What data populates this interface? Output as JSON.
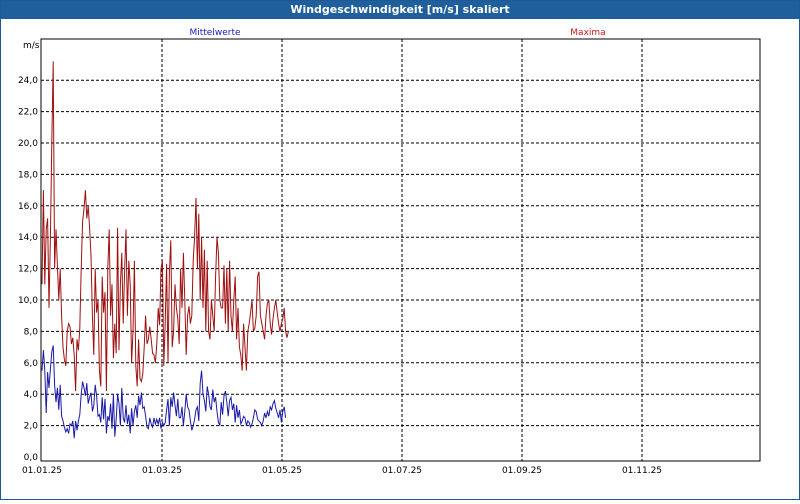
{
  "window": {
    "title": "Windgeschwindigkeit [m/s] skaliert"
  },
  "legend": {
    "series_1": "Mittelwerte",
    "series_2": "Maxima"
  },
  "colors": {
    "mean": "#1a1aa8",
    "max": "#a01010",
    "grid": "#000000",
    "legend_mean": "#1a1acc",
    "legend_max": "#cc1a1a"
  },
  "chart_data": {
    "type": "line",
    "title": "Windgeschwindigkeit [m/s] skaliert",
    "ylabel": "m/s",
    "ylim": [
      0,
      25
    ],
    "yticks": [
      "0,0",
      "2,0",
      "4,0",
      "6,0",
      "8,0",
      "10,0",
      "12,0",
      "14,0",
      "16,0",
      "18,0",
      "20,0",
      "22,0",
      "24,0"
    ],
    "xticks": [
      "01.01.25",
      "01.03.25",
      "01.05.25",
      "01.07.25",
      "01.09.25",
      "01.11.25"
    ],
    "grid": true,
    "legend_position": "top",
    "series": [
      {
        "name": "Mittelwerte",
        "values": [
          5.5,
          6.8,
          5.5,
          2.8,
          5.4,
          4.4,
          5.6,
          6.7,
          7.1,
          4.6,
          3.5,
          4.4,
          3.0,
          4.6,
          2.6,
          2.3,
          1.9,
          1.6,
          1.8,
          1.5,
          2.1,
          2.0,
          2.3,
          1.2,
          2.3,
          1.7,
          2.3,
          2.7,
          4.0,
          4.8,
          4.4,
          3.9,
          4.7,
          3.4,
          3.8,
          4.1,
          2.9,
          3.3,
          4.6,
          3.9,
          2.6,
          2.7,
          2.2,
          3.8,
          2.4,
          3.7,
          1.5,
          2.6,
          2.3,
          3.4,
          1.8,
          4.0,
          1.3,
          2.4,
          4.0,
          3.4,
          2.0,
          4.4,
          2.5,
          2.2,
          3.3,
          2.1,
          2.7,
          1.5,
          3.1,
          2.0,
          2.9,
          3.3,
          2.5,
          3.9,
          3.3,
          4.1,
          3.1,
          3.2,
          2.6,
          1.9,
          1.8,
          2.5,
          2.1,
          1.9,
          2.5,
          2.1,
          2.4,
          2.1,
          2.5,
          1.8,
          2.2,
          2.0,
          2.2,
          3.0,
          3.7,
          2.0,
          3.8,
          3.2,
          4.1,
          3.3,
          2.6,
          3.7,
          2.5,
          2.5,
          3.2,
          2.0,
          2.9,
          4.0,
          3.2,
          3.0,
          2.3,
          1.7,
          2.0,
          2.4,
          3.0,
          3.2,
          2.3,
          4.7,
          5.5,
          4.0,
          3.6,
          2.9,
          4.5,
          4.0,
          3.2,
          3.0,
          4.3,
          3.5,
          3.8,
          2.9,
          2.2,
          2.0,
          3.5,
          2.7,
          3.9,
          4.2,
          3.5,
          2.6,
          3.6,
          3.8,
          3.0,
          3.4,
          2.2,
          3.3,
          2.5,
          3.0,
          2.1,
          2.3,
          2.6,
          2.5,
          2.0,
          2.3,
          2.2,
          1.9,
          2.1,
          2.5,
          3.0,
          2.9,
          2.4,
          2.3,
          2.2,
          2.0,
          2.3,
          2.8,
          2.5,
          2.9,
          2.6,
          3.2,
          3.0,
          3.4,
          3.6,
          3.1,
          2.8,
          2.5,
          3.0,
          2.2,
          2.9,
          3.2,
          2.5
        ]
      },
      {
        "name": "Maxima",
        "values": [
          11.0,
          17.0,
          11.0,
          14.5,
          15.2,
          9.5,
          14.0,
          20.0,
          25.2,
          12.0,
          14.5,
          12.2,
          10.0,
          12.0,
          9.0,
          7.0,
          6.2,
          5.8,
          8.0,
          8.5,
          8.3,
          7.2,
          7.6,
          6.5,
          4.2,
          7.5,
          6.8,
          8.2,
          12.0,
          15.0,
          15.8,
          17.0,
          15.2,
          16.0,
          14.6,
          12.8,
          9.0,
          6.5,
          12.0,
          9.2,
          10.0,
          5.5,
          4.5,
          11.5,
          9.2,
          10.5,
          4.2,
          12.0,
          14.5,
          9.0,
          11.0,
          6.3,
          8.5,
          6.6,
          14.6,
          6.8,
          11.0,
          13.0,
          8.5,
          11.8,
          14.5,
          9.0,
          12.5,
          11.0,
          6.0,
          8.0,
          12.5,
          5.8,
          4.5,
          7.5,
          5.0,
          4.8,
          5.3,
          7.0,
          9.0,
          7.2,
          7.5,
          8.3,
          7.5,
          6.6,
          6.5,
          6.0,
          7.2,
          9.5,
          8.4,
          12.0,
          12.5,
          5.8,
          8.5,
          12.3,
          6.0,
          11.8,
          13.8,
          7.0,
          8.0,
          11.0,
          9.5,
          8.8,
          7.2,
          12.0,
          9.5,
          13.0,
          10.0,
          6.5,
          9.0,
          9.6,
          8.5,
          9.0,
          12.5,
          14.0,
          16.5,
          12.0,
          15.5,
          10.0,
          14.0,
          9.5,
          13.2,
          8.0,
          12.5,
          8.0,
          7.5,
          10.0,
          9.0,
          8.0,
          11.5,
          14.0,
          13.0,
          10.0,
          9.5,
          9.5,
          12.2,
          8.5,
          12.0,
          8.0,
          12.5,
          9.0,
          8.0,
          10.0,
          11.5,
          7.5,
          9.5,
          7.0,
          6.5,
          5.5,
          8.5,
          7.0,
          5.5,
          8.0,
          8.5,
          9.2,
          10.0,
          8.0,
          8.2,
          9.0,
          11.5,
          11.8,
          9.0,
          8.5,
          8.0,
          7.5,
          9.0,
          9.8,
          10.0,
          8.5,
          7.8,
          8.8,
          9.5,
          10.0,
          9.2,
          8.5,
          8.0,
          8.5,
          8.8,
          9.5,
          8.0,
          7.6,
          8.0
        ]
      }
    ]
  }
}
